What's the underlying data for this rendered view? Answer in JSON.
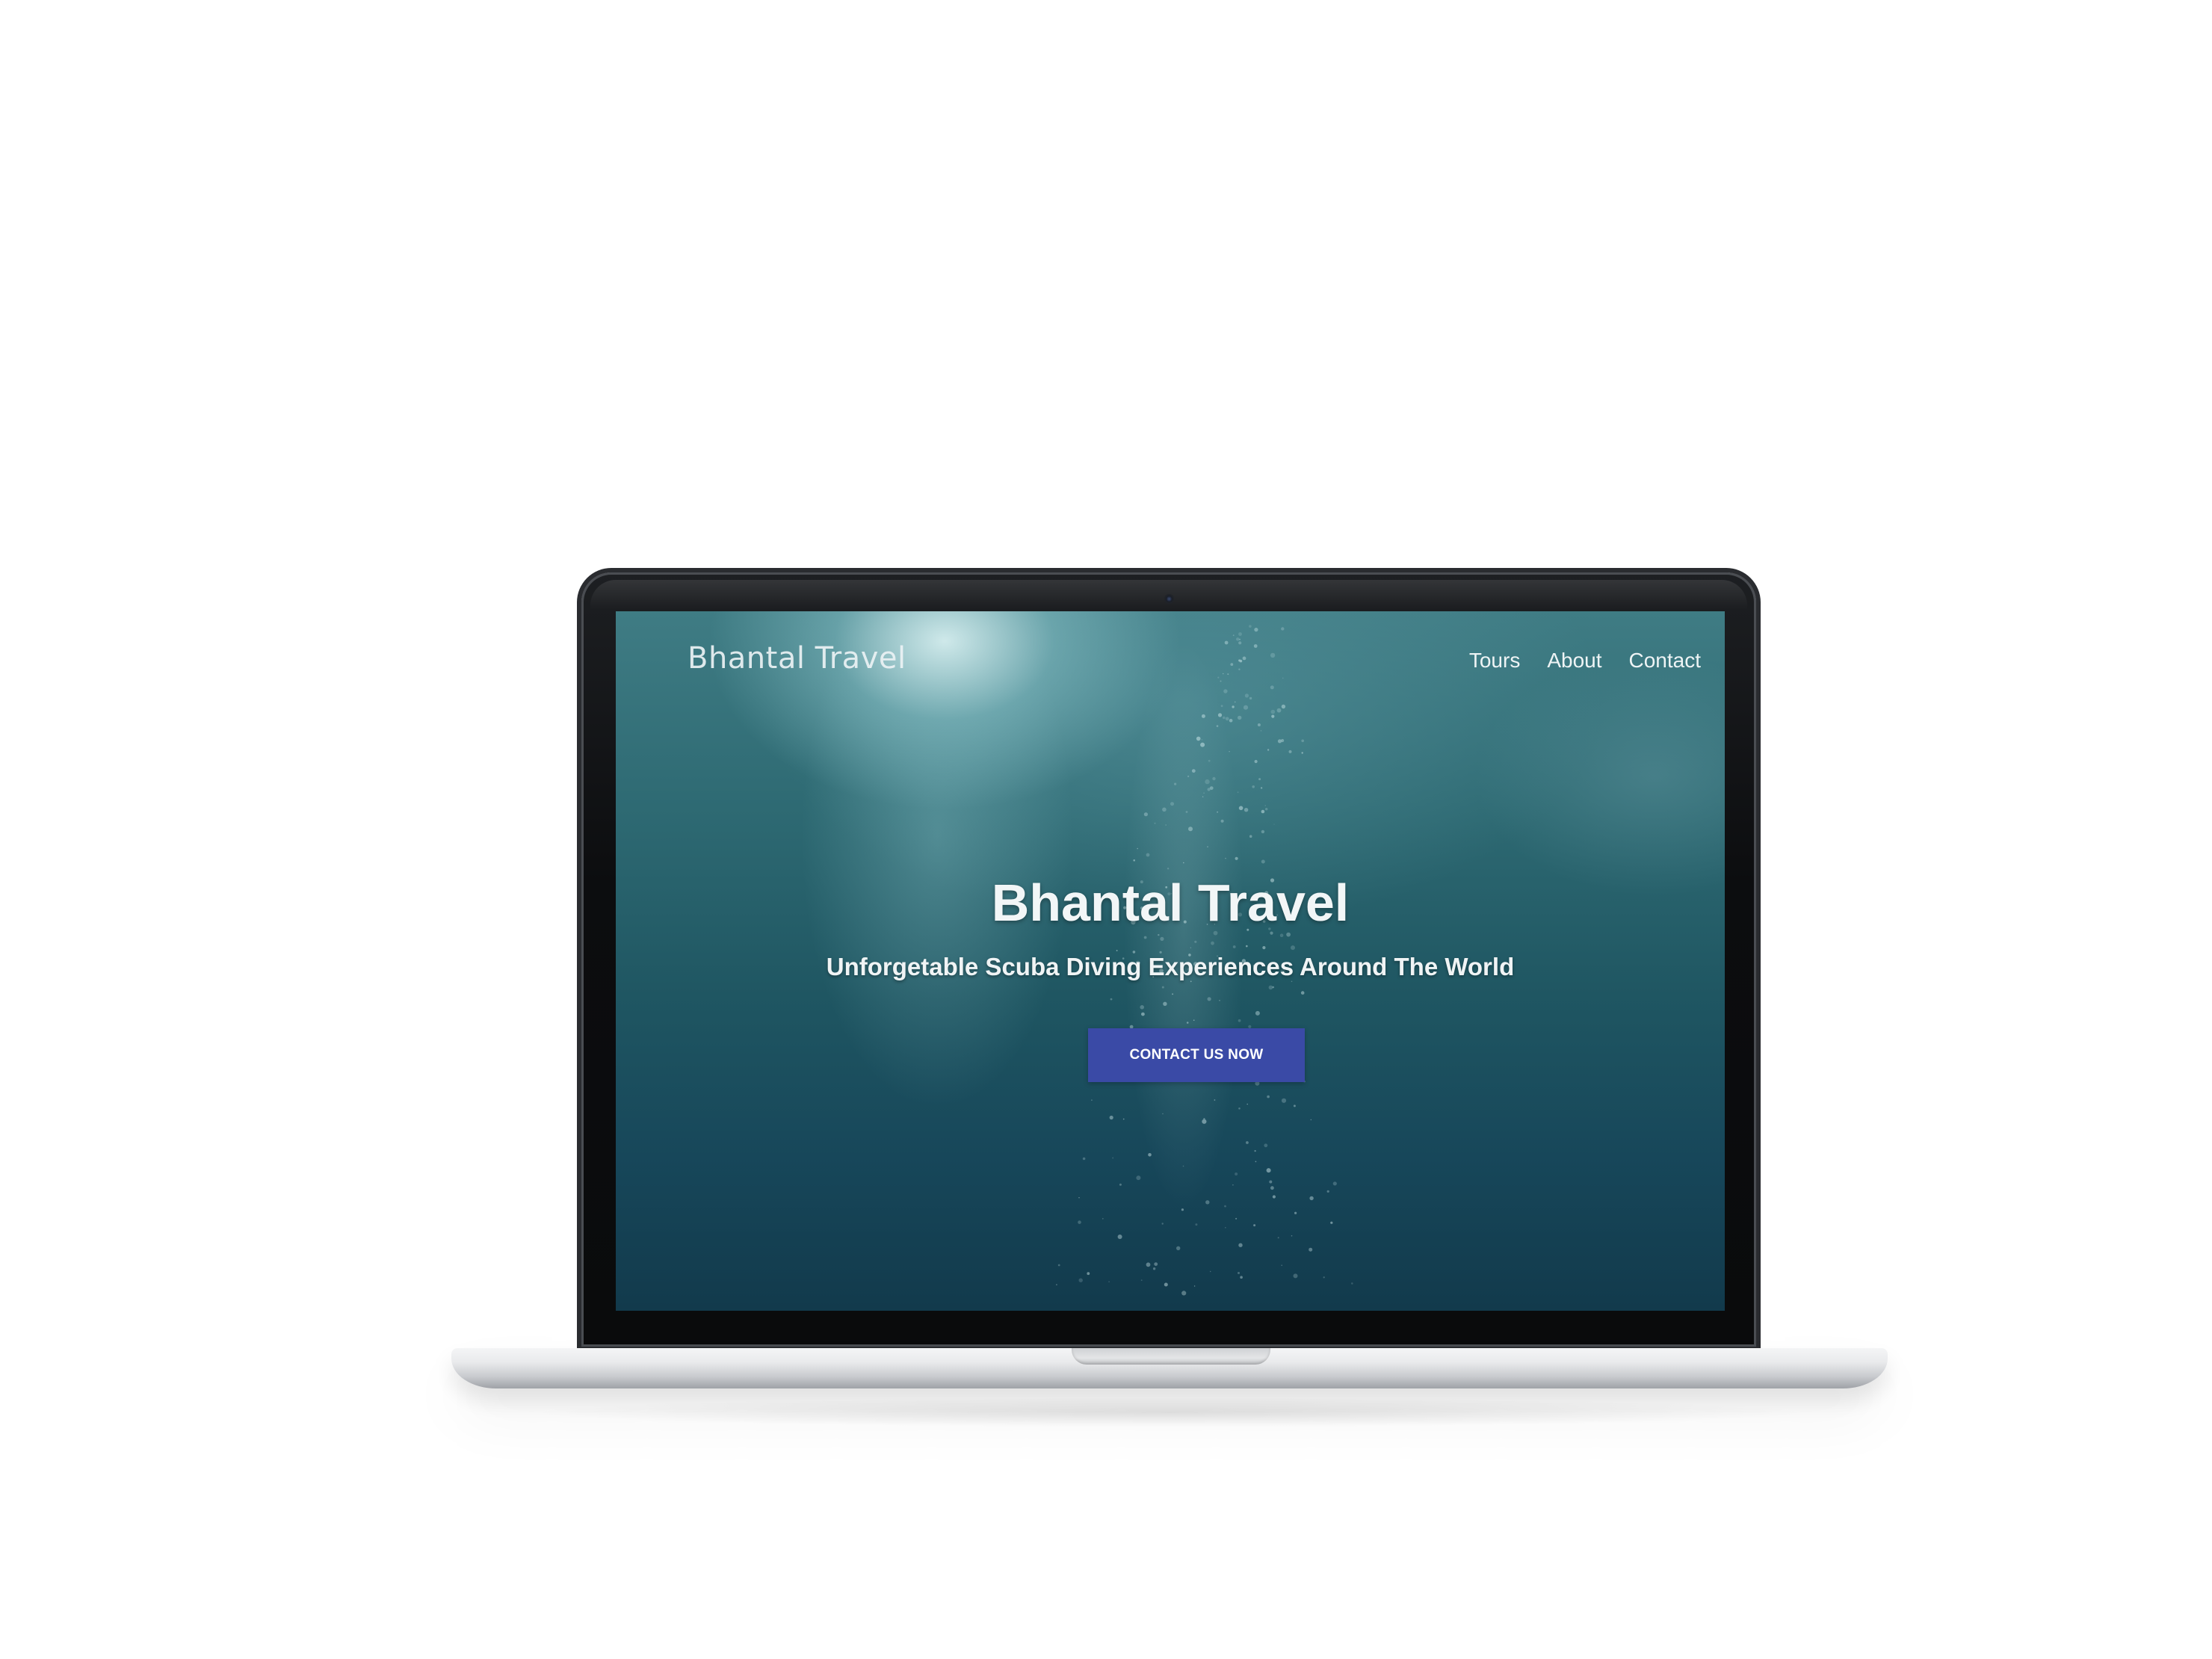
{
  "site": {
    "brand": "Bhantal Travel",
    "nav": [
      {
        "label": "Tours"
      },
      {
        "label": "About"
      },
      {
        "label": "Contact"
      }
    ]
  },
  "hero": {
    "title": "Bhantal Travel",
    "subtitle": "Unforgetable Scuba Diving Experiences Around The World",
    "cta_label": "CONTACT US NOW"
  },
  "colors": {
    "cta_background": "#3a4aa6",
    "ocean_deep": "#123a4c",
    "ocean_light": "#3f7c84",
    "text": "#f2f6f7"
  }
}
